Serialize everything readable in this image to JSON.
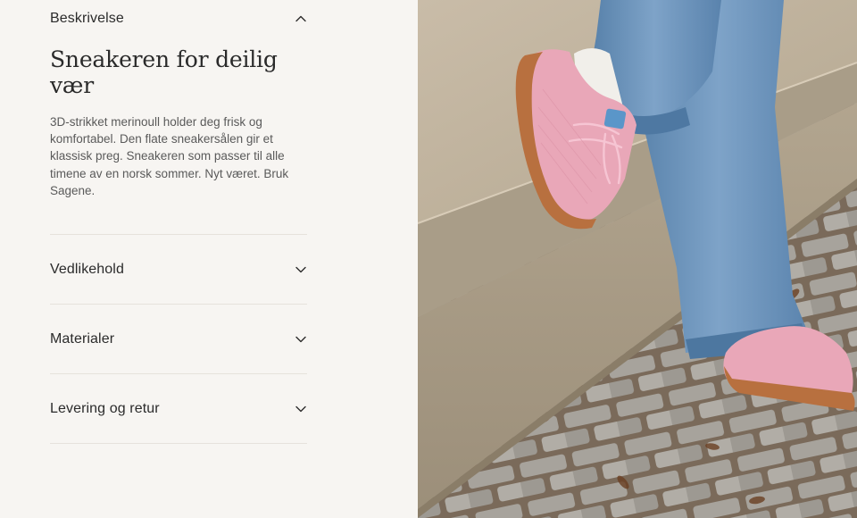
{
  "accordion": {
    "open_section": {
      "label": "Beskrivelse",
      "title": "Sneakeren for deilig vær",
      "body": "3D-strikket merinoull holder deg frisk og komfortabel. Den flate sneakersålen gir et klassisk preg. Sneakeren som passer til alle timene av en norsk sommer. Nyt været. Bruk Sagene."
    },
    "sections": [
      {
        "label": "Vedlikehold"
      },
      {
        "label": "Materialer"
      },
      {
        "label": "Levering og retur"
      }
    ]
  },
  "product_image": {
    "alt": "Pink knitted sneakers with gum sole worn with wide blue jeans on a stone step",
    "shoe_color": "#e9a7b8",
    "sole_color": "#b8703f",
    "denim_color": "#6f97bf"
  },
  "colors": {
    "background": "#f7f5f2",
    "text": "#2a2a2a",
    "muted_text": "#5a5a5a",
    "divider": "#e6e2dc"
  }
}
